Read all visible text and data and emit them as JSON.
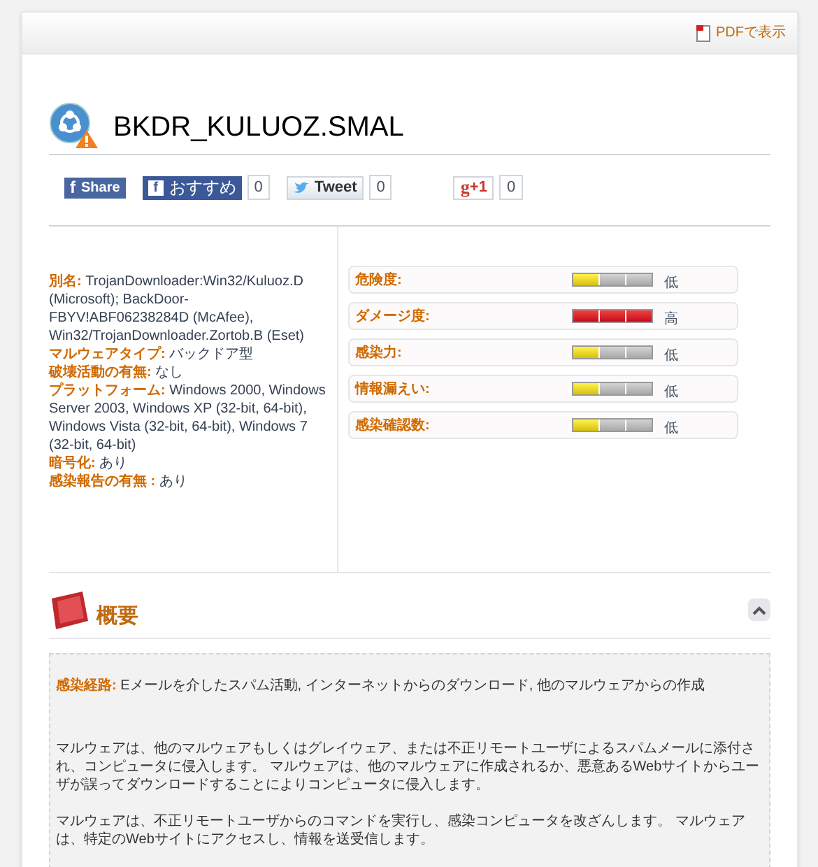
{
  "header": {
    "pdf_link": "PDFで表示"
  },
  "title": "BKDR_KULUOZ.SMAL",
  "social": [
    {
      "kind": "facebook-share",
      "icon": "f",
      "label": "Share"
    },
    {
      "kind": "facebook-recommend",
      "icon": "f",
      "label": "おすすめ",
      "count": "0"
    },
    {
      "kind": "tweet",
      "label": "Tweet",
      "count": "0"
    },
    {
      "kind": "gplus",
      "icon": "g",
      "label": "+1",
      "count": "0"
    }
  ],
  "details": [
    "**別名:** TrojanDownloader:Win32/Kuluoz.D (Microsoft); BackDoor-FBYV!ABF06238284D (McAfee), Win32/TrojanDownloader.Zortob.B (Eset)",
    "**マルウェアタイプ:** バックドア型",
    "**破壊活動の有無:** なし",
    "**プラットフォーム:** Windows 2000, Windows Server 2003, Windows XP (32-bit, 64-bit), Windows Vista (32-bit, 64-bit), Windows 7 (32-bit, 64-bit)",
    "**暗号化:** あり",
    "**感染報告の有無 :** あり"
  ],
  "ratings": [
    {
      "label": "危険度:",
      "level": 0.33,
      "reading": "低"
    },
    {
      "label": "ダメージ度:",
      "level": 1,
      "reading": "高"
    },
    {
      "label": "感染力:",
      "level": 0.33,
      "reading": "低"
    },
    {
      "label": "情報漏えい:",
      "level": 0.33,
      "reading": "低"
    },
    {
      "label": "感染確認数:",
      "level": 0.33,
      "reading": "低"
    }
  ],
  "overview": {
    "title": "概要",
    "expanded": true,
    "infection_label": "感染経路:",
    "infection_value": "Eメールを介したスパム活動, インターネットからのダウンロード, 他のマルウェアからの作成",
    "paragraphs": [
      "マルウェアは、他のマルウェアもしくはグレイウェア、または不正リモートユーザによるスパムメールに添付され、コンピュータに侵入します。 マルウェアは、他のマルウェアに作成されるか、悪意あるWebサイトからユーザが誤ってダウンロードすることによりコンピュータに侵入します。",
      "マルウェアは、不正リモートユーザからのコマンドを実行し、感染コンピュータを改ざんします。 マルウェアは、特定のWebサイトにアクセスし、情報を送受信します。"
    ]
  }
}
